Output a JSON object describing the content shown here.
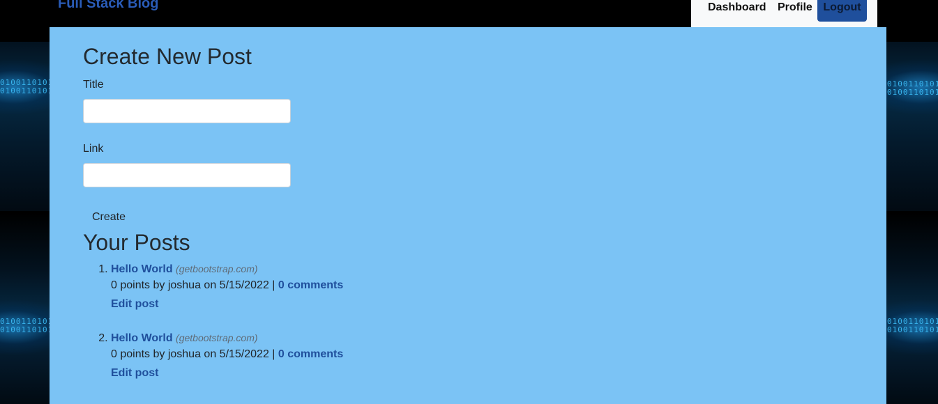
{
  "app": {
    "brand": "Full Stack Blog"
  },
  "nav": {
    "items": [
      {
        "label": "Dashboard"
      },
      {
        "label": "Profile"
      },
      {
        "label": "Logout"
      }
    ]
  },
  "form": {
    "heading": "Create New Post",
    "title_label": "Title",
    "title_value": "",
    "link_label": "Link",
    "link_value": "",
    "submit_label": "Create"
  },
  "posts": {
    "heading": "Your Posts",
    "items": [
      {
        "title": "Hello World",
        "domain": "(getbootstrap.com)",
        "meta": "0 points by joshua on 5/15/2022 |",
        "comments": "0 comments",
        "edit": "Edit post"
      },
      {
        "title": "Hello World",
        "domain": "(getbootstrap.com)",
        "meta": "0 points by joshua on 5/15/2022 |",
        "comments": "0 comments",
        "edit": "Edit post"
      }
    ]
  },
  "background": {
    "decor_text": "0100110101"
  },
  "colors": {
    "panel": "#7bc3f5",
    "link": "#1f4f9c",
    "logout_bg": "#1f4f9c",
    "nav_bg": "#f8f9fa",
    "page_bg": "#000000"
  }
}
